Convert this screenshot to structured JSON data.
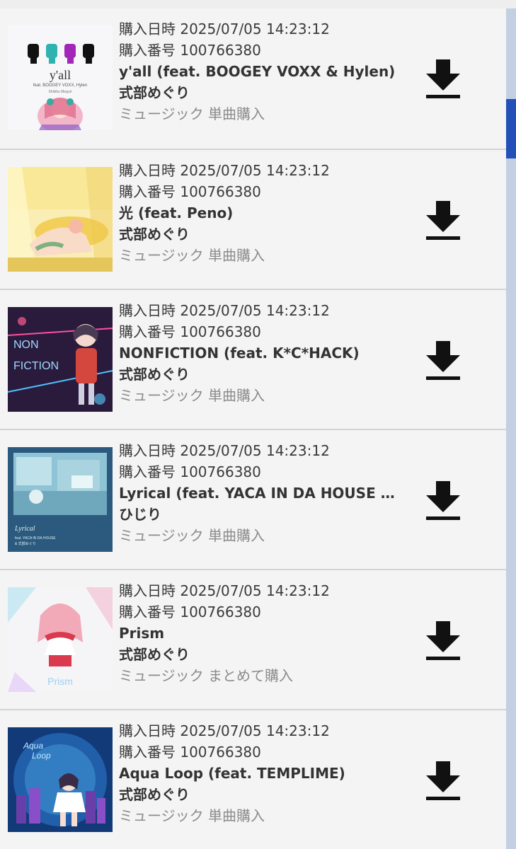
{
  "colors": {
    "background": "#f4f4f4",
    "divider": "#d4d4d4",
    "scroll_track": "#c3cfe2",
    "scroll_thumb": "#2250b8",
    "type_text": "#8b8b8b"
  },
  "items": [
    {
      "date": "購入日時 2025/07/05 14:23:12",
      "order": "購入番号 100766380",
      "title": "y'all (feat. BOOGEY VOXX & Hylen)",
      "artist": "式部めぐり",
      "type": "ミュージック 単曲購入",
      "cover": {
        "title_text": "y'all",
        "subtitle_text": "feat. BOOGEY VOXX, Hylen",
        "credit_text": "Shikibu Meguri"
      }
    },
    {
      "date": "購入日時 2025/07/05 14:23:12",
      "order": "購入番号 100766380",
      "title": "光 (feat. Peno)",
      "artist": "式部めぐり",
      "type": "ミュージック 単曲購入"
    },
    {
      "date": "購入日時 2025/07/05 14:23:12",
      "order": "購入番号 100766380",
      "title": "NONFICTION (feat. K*C*HACK)",
      "artist": "式部めぐり",
      "type": "ミュージック 単曲購入",
      "cover": {
        "line1": "NON",
        "line2": "FICTION"
      }
    },
    {
      "date": "購入日時 2025/07/05 14:23:12",
      "order": "購入番号 100766380",
      "title": "Lyrical (feat. YACA IN DA HOUSE & 式…",
      "artist": "ひじり",
      "type": "ミュージック 単曲購入",
      "cover": {
        "line1": "Lyrical",
        "line2": "feat. YACA IN DA HOUSE",
        "line3": "& 式部めぐり"
      }
    },
    {
      "date": "購入日時 2025/07/05 14:23:12",
      "order": "購入番号 100766380",
      "title": "Prism",
      "artist": "式部めぐり",
      "type": "ミュージック まとめて購入",
      "cover": {
        "title_text": "Prism"
      }
    },
    {
      "date": "購入日時 2025/07/05 14:23:12",
      "order": "購入番号 100766380",
      "title": "Aqua Loop (feat. TEMPLIME)",
      "artist": "式部めぐり",
      "type": "ミュージック 単曲購入",
      "cover": {
        "line1": "Aqua",
        "line2": "Loop"
      }
    }
  ],
  "icons": {
    "download": "download-icon"
  }
}
